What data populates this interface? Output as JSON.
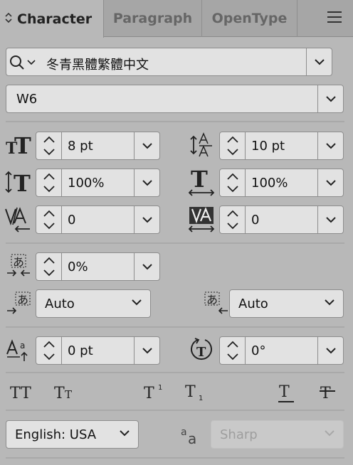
{
  "tabs": [
    {
      "label": "Character",
      "active": true
    },
    {
      "label": "Paragraph",
      "active": false
    },
    {
      "label": "OpenType",
      "active": false
    }
  ],
  "font_family": "冬青黑體繁體中文",
  "font_style": "W6",
  "font_size": "8 pt",
  "leading": "10 pt",
  "vertical_scale": "100%",
  "horizontal_scale": "100%",
  "kerning": "0",
  "tracking": "0",
  "tsume": "0%",
  "aki_left": "Auto",
  "aki_right": "Auto",
  "baseline_shift": "0 pt",
  "rotation": "0°",
  "language": "English: USA",
  "anti_aliasing": "Sharp",
  "colors": {
    "panel": "#b8b8b8",
    "field": "#e2e2e2",
    "tabbar": "#a6a6a6"
  }
}
